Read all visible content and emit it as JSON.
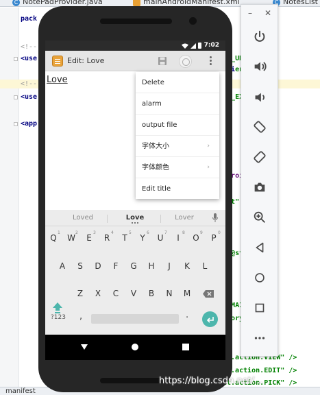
{
  "ide": {
    "tabs": [
      {
        "icon": "c-class-icon",
        "label": "NotePadProvider.java"
      },
      {
        "icon": "xml-file-icon",
        "label": "mainAndroidManifest.xml"
      },
      {
        "icon": "c-class-icon",
        "label": "NotesList"
      }
    ],
    "left_lines": [
      {
        "text": "pack",
        "comment": false
      },
      {
        "text": "<!--",
        "comment": true
      },
      {
        "text": "<use",
        "comment": false
      },
      {
        "text": "<!--",
        "comment": true
      },
      {
        "text": "<use",
        "comment": false
      },
      {
        "text": "<app",
        "comment": false
      }
    ],
    "right_lines": [
      {
        "text": "ss",
        "suffix": "_UNMOUNT"
      },
      {
        "text": "ssi",
        "suffix": "ent\" />"
      },
      {
        "text": "ss",
        "suffix": "_EXTERNA"
      },
      {
        "text": "ss",
        "suffix": ""
      },
      {
        "text": "do",
        "suffix": "roid:proc"
      },
      {
        "text": "de",
        "suffix": "t\""
      },
      {
        "text": "te",
        "suffix": ""
      },
      {
        "text": "id",
        "suffix": "@string/t"
      },
      {
        "text": "ol",
        "suffix": ""
      },
      {
        "text": "nt",
        "suffix": "MAIN\" />"
      },
      {
        "text": "te",
        "suffix": "ory.LAUNC"
      },
      {
        "text": "l",
        "suffix": ""
      },
      {
        "text": "nt.action.VIEW\" />",
        "suffix": ""
      },
      {
        "text": "nt.action.EDIT\" />",
        "suffix": ""
      },
      {
        "text": "nt.action.PICK\" />",
        "suffix": ""
      }
    ],
    "bottom_tab": "manifest",
    "watermark": "https://blog.csdn.net/..."
  },
  "emulator_panel": {
    "minimize": "–",
    "close": "✕",
    "buttons": [
      "power-icon",
      "volume-up-icon",
      "volume-down-icon",
      "rotate-left-icon",
      "rotate-right-icon",
      "camera-icon",
      "zoom-icon",
      "back-icon",
      "home-icon",
      "overview-icon",
      "more-icon"
    ]
  },
  "phone": {
    "status_time": "7:02",
    "action_bar_title": "Edit: Love",
    "note_text": "Love",
    "menu_items": [
      {
        "label": "Delete",
        "submenu": false
      },
      {
        "label": "alarm",
        "submenu": false
      },
      {
        "label": "output file",
        "submenu": false
      },
      {
        "label": "字体大小",
        "submenu": true
      },
      {
        "label": "字体颜色",
        "submenu": true
      },
      {
        "label": "Edit title",
        "submenu": false
      }
    ],
    "suggestions": [
      "Loved",
      "Love",
      "Lover"
    ],
    "keyboard": {
      "row1": [
        "Q",
        "W",
        "E",
        "R",
        "T",
        "Y",
        "U",
        "I",
        "O",
        "P"
      ],
      "row1_hints": [
        "1",
        "2",
        "3",
        "4",
        "5",
        "6",
        "7",
        "8",
        "9",
        "0"
      ],
      "row2": [
        "A",
        "S",
        "D",
        "F",
        "G",
        "H",
        "J",
        "K",
        "L"
      ],
      "row3": [
        "Z",
        "X",
        "C",
        "V",
        "B",
        "N",
        "M"
      ],
      "sym_key": "?123",
      "comma": ",",
      "period": "."
    }
  },
  "colors": {
    "enter_key": "#4db6ac",
    "action_bar": "#e5e5e5",
    "status_bar": "#2c2c2c"
  }
}
